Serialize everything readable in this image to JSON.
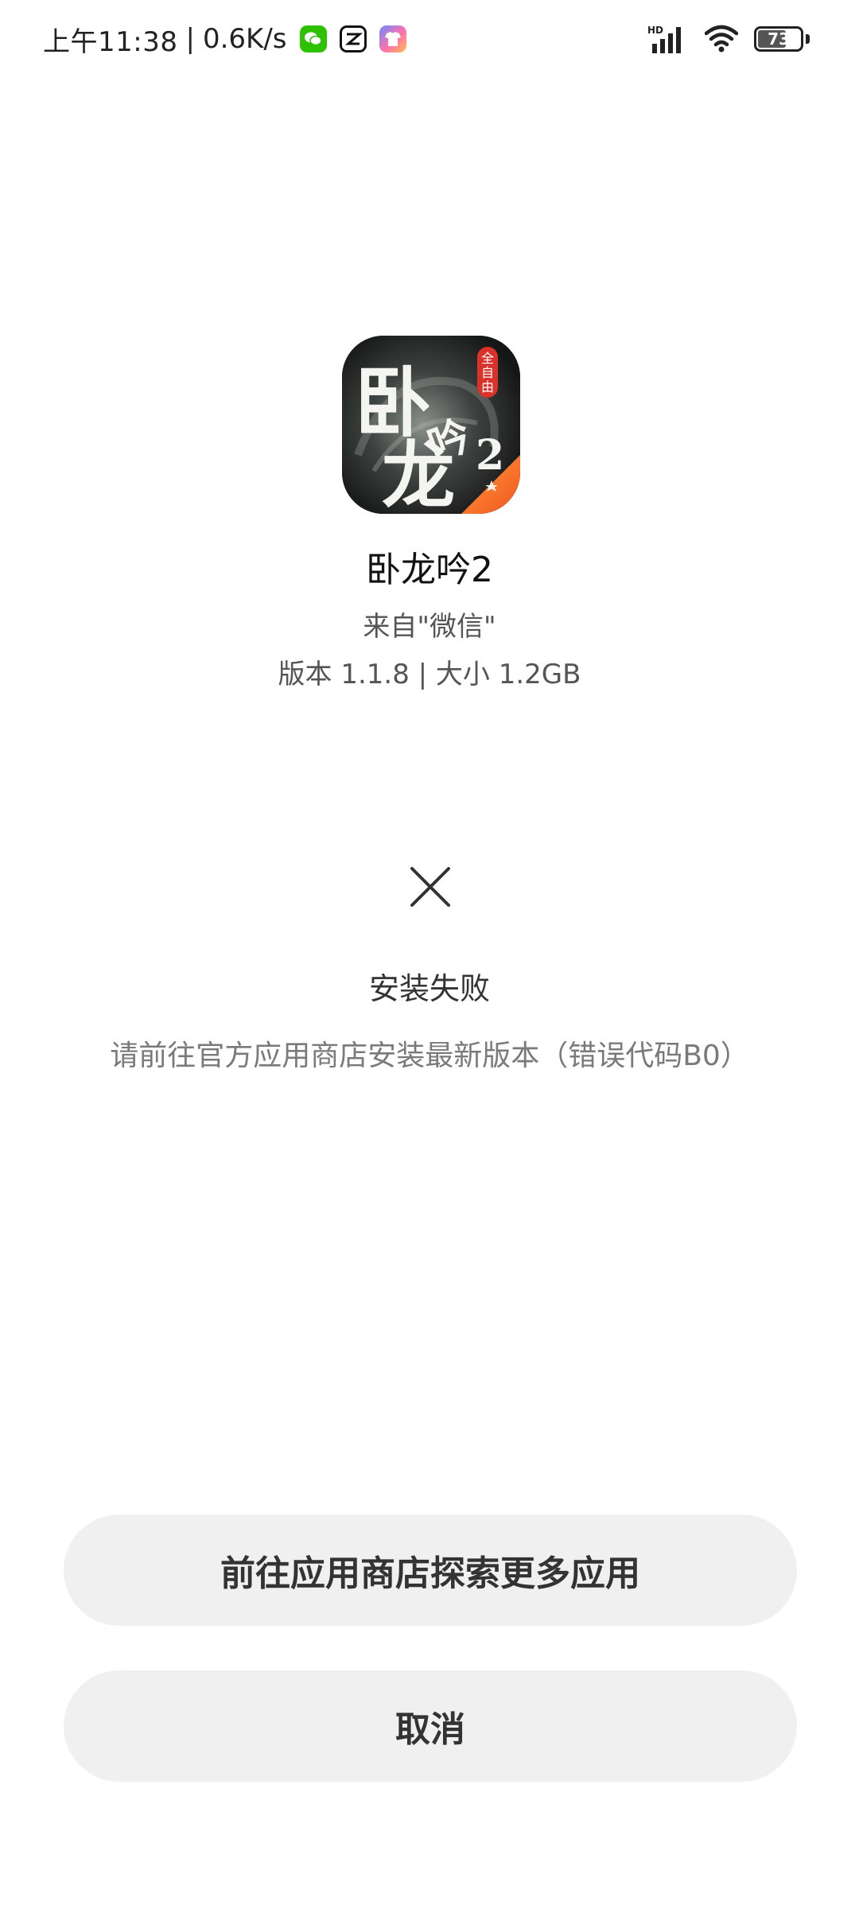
{
  "status_bar": {
    "time": "上午11:38",
    "separator": "|",
    "net_speed": "0.6K/s",
    "notification_icons": [
      "wechat-icon",
      "capcut-icon",
      "tshirt-app-icon"
    ],
    "network_label": "HD",
    "battery_level": "73",
    "battery_fraction": 0.73
  },
  "app": {
    "icon_text": [
      "卧",
      "龙",
      "吟",
      "2"
    ],
    "badge_text": "全自由",
    "name": "卧龙吟2",
    "source": "来自\"微信\"",
    "meta": "版本 1.1.8 | 大小 1.2GB"
  },
  "result": {
    "icon": "close-x-icon",
    "title": "安装失败",
    "description": "请前往官方应用商店安装最新版本（错误代码B0）"
  },
  "actions": {
    "store_label": "前往应用商店探索更多应用",
    "cancel_label": "取消"
  },
  "colors": {
    "button_bg": "#f0f0f0",
    "wechat_green": "#2dc100",
    "badge_red": "#d8322b"
  }
}
